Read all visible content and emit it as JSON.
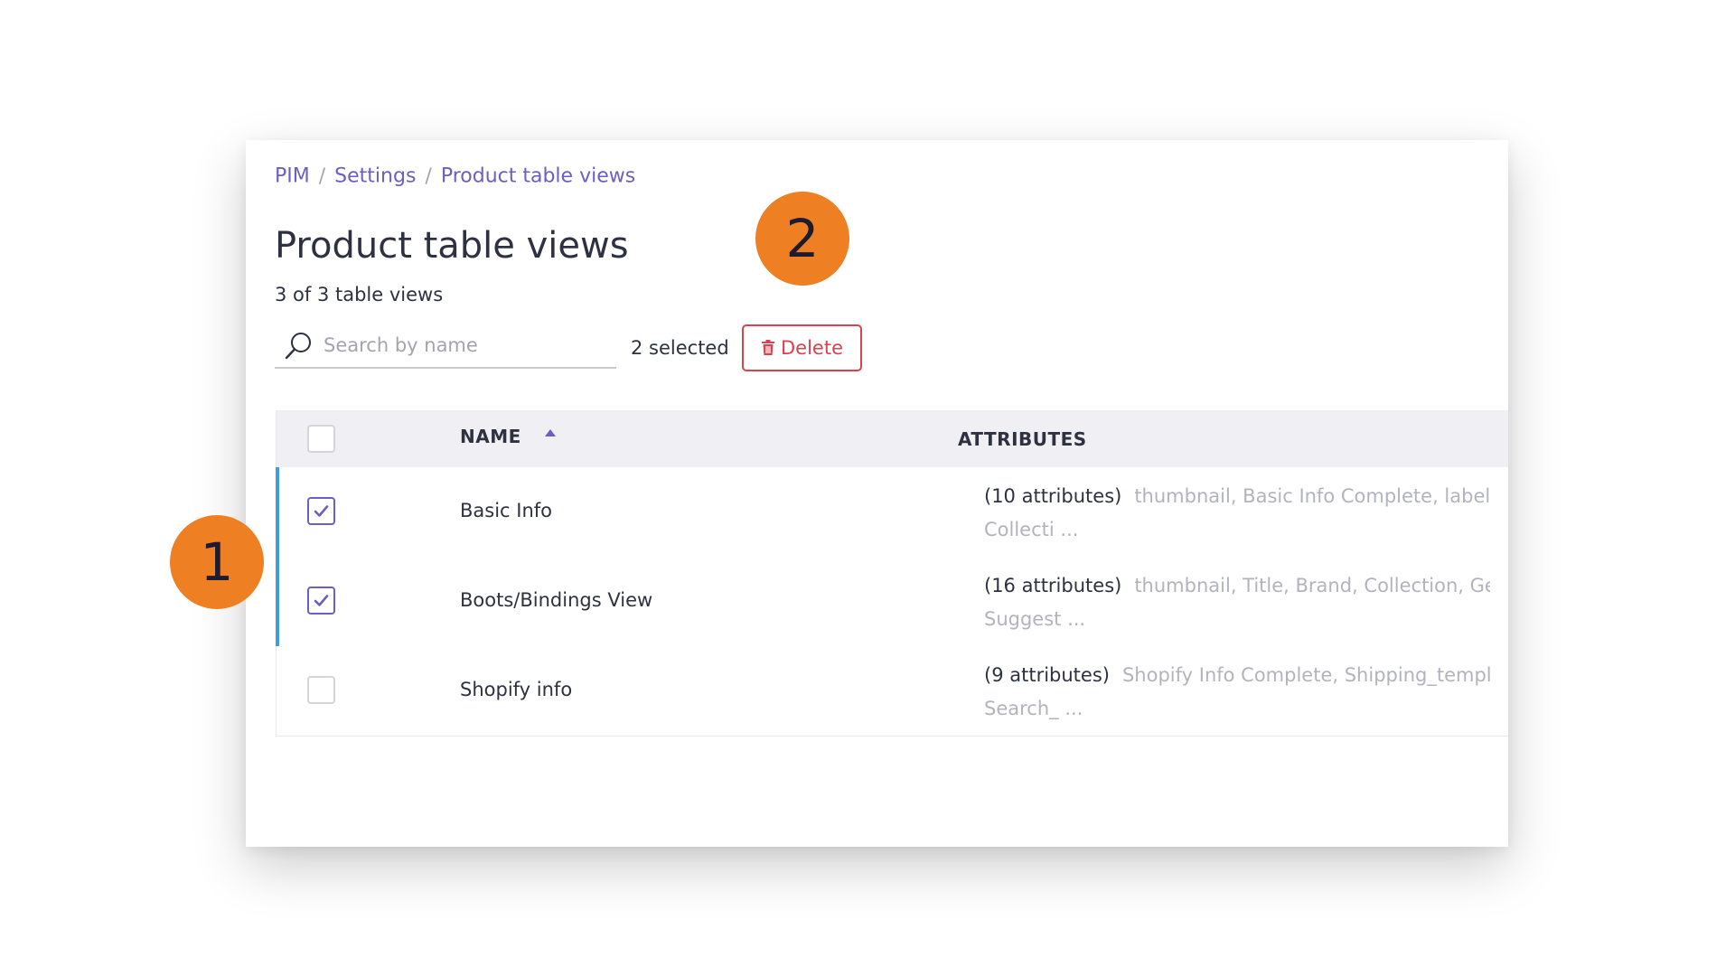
{
  "breadcrumb": {
    "items": [
      "PIM",
      "Settings",
      "Product table views"
    ],
    "separator": "/"
  },
  "page": {
    "title": "Product table views",
    "count_text": "3 of 3 table views"
  },
  "search": {
    "placeholder": "Search by name",
    "value": ""
  },
  "toolbar": {
    "selected_text": "2 selected",
    "delete_label": "Delete"
  },
  "table": {
    "columns": [
      "NAME",
      "ATTRIBUTES"
    ],
    "sort_column": "NAME",
    "header_checked": false,
    "rows": [
      {
        "name": "Basic Info",
        "checked": true,
        "attr_count": "(10 attributes)",
        "attr_line1": "thumbnail, Basic Info Complete, label, (",
        "attr_line2": "Collecti ..."
      },
      {
        "name": "Boots/Bindings View",
        "checked": true,
        "attr_count": "(16 attributes)",
        "attr_line1": "thumbnail, Title, Brand, Collection, Ger",
        "attr_line2": "Suggest ..."
      },
      {
        "name": "Shopify info",
        "checked": false,
        "attr_count": "(9 attributes)",
        "attr_line1": "Shopify Info Complete, Shipping_templa",
        "attr_line2": "Search_ ..."
      }
    ]
  },
  "callouts": [
    "1",
    "2"
  ],
  "colors": {
    "accent": "#6b5fc1",
    "danger": "#d9434f",
    "selection_bar": "#3f9ddc",
    "callout": "#ee7f22"
  },
  "icons": {
    "search": "search-icon",
    "delete": "trash-icon",
    "sort": "sort-ascending-icon",
    "check": "check-icon"
  }
}
